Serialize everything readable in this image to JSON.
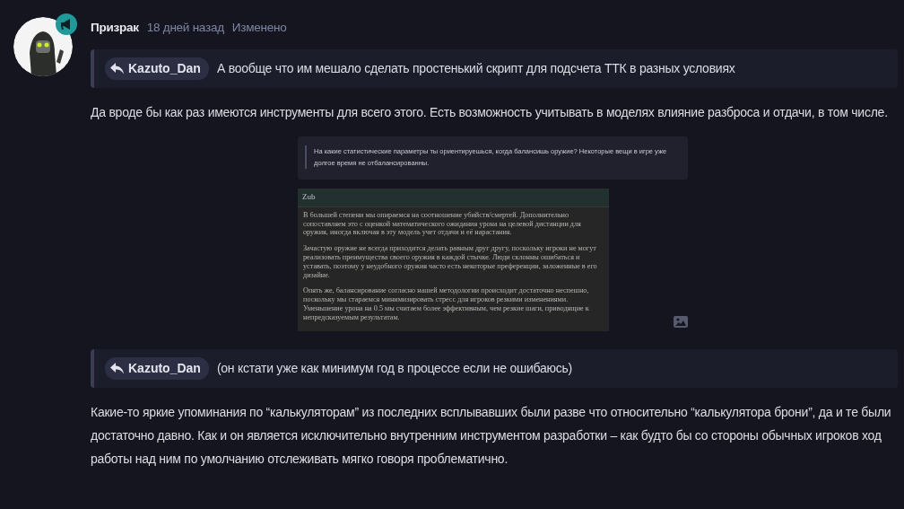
{
  "post": {
    "author": "Призрак",
    "time": "18 дней назад",
    "edited_label": "Изменено",
    "blocks": [
      {
        "kind": "quote",
        "user": "Kazuto_Dan",
        "text": "А вообще что им мешало сделать простенький скрипт для подсчета ТТК в разных условиях"
      },
      {
        "kind": "paragraph",
        "text": "Да вроде бы как раз имеются инструменты для всего этого. Есть возможность учитывать в моделях влияние разброса и отдачи, в том числе."
      },
      {
        "kind": "screenshot",
        "question": "На какие статистические параметры ты ориентируешься, когда балансишь оружие? Некоторые вещи в игре уже долгое время не отбалансированны.",
        "answer_author": "Zub",
        "answer": [
          "В большей степени мы опираемся на соотношение убийств/смертей. Дополнительно сопоставляем это с оценкой математического ожидания урона на целевой дистанции для оружия, иногда включая в эту модель учет отдачи и её нарастания.",
          "Зачастую оружие не всегда приходится делать равным друг другу, поскольку игроки не могут реализовать преимущества своего оружия в каждой стычке. Люди склонны ошибаться и уставать, поэтому у неудобного оружия часто есть некоторые преференции, заложенные в его дизайне.",
          "Опять же, балансирование согласно нашей методологии происходит достаточно неспешно, поскольку мы стараемся минимизировать стресс для игроков резкими изменениями. Уменьшение урона на 0.5 мы считаем более эффективным, чем резкие шаги, приводящие к непредсказуемым результатам."
        ]
      },
      {
        "kind": "quote",
        "user": "Kazuto_Dan",
        "text": "(он кстати уже как минимум год в процессе если не ошибаюсь)"
      },
      {
        "kind": "paragraph",
        "text": "Какие-то яркие упоминания по “калькуляторам” из последних всплывавших были разве что относительно “калькулятора брони”, да и те были достаточно давно. Как и он является исключительно внутренним инструментом разработки – как будто бы со стороны обычных игроков ход работы над ним по умолчанию отслеживать мягко говоря проблематично."
      }
    ]
  }
}
